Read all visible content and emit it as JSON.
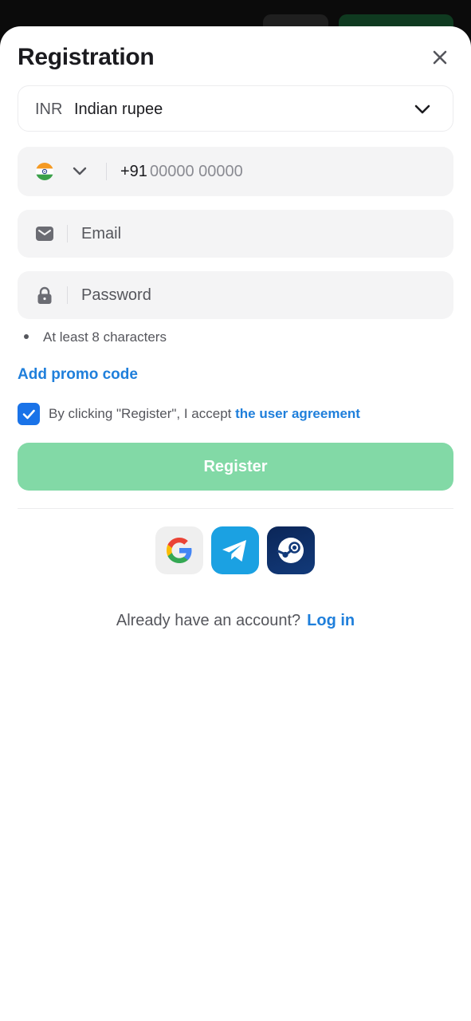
{
  "title": "Registration",
  "currency": {
    "code": "INR",
    "name": "Indian rupee"
  },
  "phone": {
    "prefix": "+91",
    "placeholder": "00000 00000"
  },
  "email": {
    "placeholder": "Email"
  },
  "password": {
    "placeholder": "Password",
    "hint": "At least 8 characters"
  },
  "promo_label": "Add promo code",
  "agreement": {
    "checked": true,
    "text": "By clicking \"Register\", I accept",
    "link": "the user agreement"
  },
  "register_label": "Register",
  "social": [
    "google-icon",
    "telegram-icon",
    "steam-icon"
  ],
  "login": {
    "prompt": "Already have an account?",
    "link": "Log in"
  },
  "colors": {
    "accent": "#1f7fdb",
    "register_bg": "#82d9a6",
    "checkbox": "#1a73e8"
  }
}
